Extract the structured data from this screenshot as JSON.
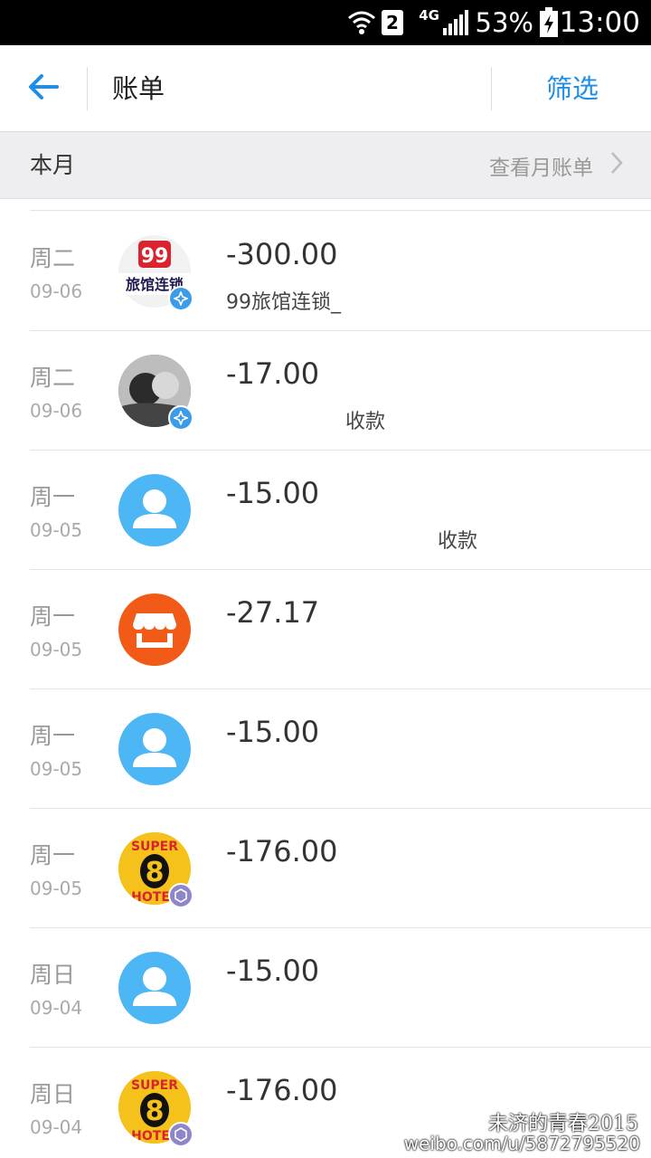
{
  "status_bar": {
    "network": "4G",
    "sim_slot": "2",
    "battery_percent": "53%",
    "time": "13:00"
  },
  "header": {
    "title": "账单",
    "filter_label": "筛选",
    "back_icon": "arrow-left-icon",
    "accent_color": "#1e8ee6"
  },
  "month_bar": {
    "label": "本月",
    "link_text": "查看月账单"
  },
  "transactions": [
    {
      "weekday": "周二",
      "date": "09-06",
      "amount": "-300.00",
      "description": "99旅馆连锁_",
      "avatar": "hotel-99-logo",
      "badge": "verified-blue"
    },
    {
      "weekday": "周二",
      "date": "09-06",
      "amount": "-17.00",
      "description": "收款",
      "avatar": "user-photo",
      "badge": "verified-blue"
    },
    {
      "weekday": "周一",
      "date": "09-05",
      "amount": "-15.00",
      "description": "收款",
      "avatar": "default-person",
      "badge": ""
    },
    {
      "weekday": "周一",
      "date": "09-05",
      "amount": "-27.17",
      "description": "",
      "avatar": "shop-store",
      "badge": ""
    },
    {
      "weekday": "周一",
      "date": "09-05",
      "amount": "-15.00",
      "description": "",
      "avatar": "default-person",
      "badge": ""
    },
    {
      "weekday": "周一",
      "date": "09-05",
      "amount": "-176.00",
      "description": "",
      "avatar": "super8-hotel-logo",
      "badge": "verified-purple"
    },
    {
      "weekday": "周日",
      "date": "09-04",
      "amount": "-15.00",
      "description": "",
      "avatar": "default-person",
      "badge": ""
    },
    {
      "weekday": "周日",
      "date": "09-04",
      "amount": "-176.00",
      "description": "",
      "avatar": "super8-hotel-logo",
      "badge": "verified-purple"
    }
  ],
  "watermark": {
    "line1": "未济的青春2015",
    "line2": "weibo.com/u/5872795520"
  }
}
